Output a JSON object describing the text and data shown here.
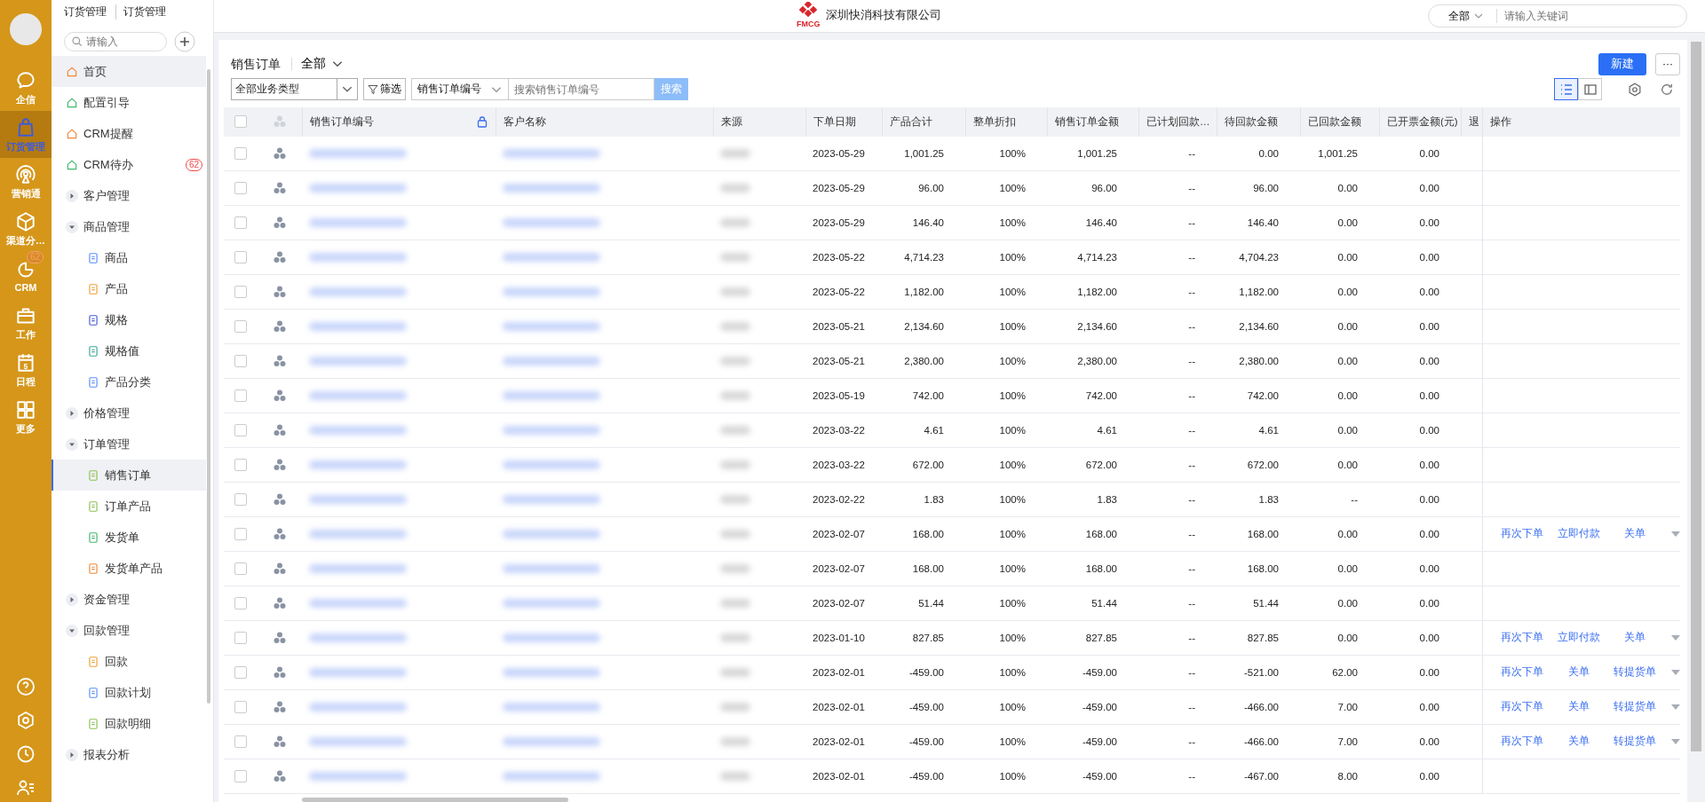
{
  "rail": {
    "items": [
      {
        "label": "企信",
        "selected": false
      },
      {
        "label": "订货管理",
        "selected": true
      },
      {
        "label": "营销通",
        "selected": false
      },
      {
        "label": "渠道分…",
        "selected": false
      },
      {
        "label": "CRM",
        "selected": false,
        "badge": "62"
      },
      {
        "label": "工作",
        "selected": false
      },
      {
        "label": "日程",
        "selected": false,
        "icon_text": "5"
      },
      {
        "label": "更多",
        "selected": false
      }
    ]
  },
  "header": {
    "breadcrumb": [
      "订货管理",
      "订货管理"
    ],
    "logo_text": "FMCG",
    "company": "深圳快消科技有限公司",
    "search": {
      "scope": "全部",
      "placeholder": "请输入关键词"
    }
  },
  "sidebar": {
    "search": {
      "placeholder": "请输入"
    },
    "items": [
      {
        "kind": "link",
        "label": "首页",
        "selected": false,
        "hovered": true
      },
      {
        "kind": "link",
        "label": "配置引导",
        "selected": false,
        "hovered": false
      },
      {
        "kind": "link",
        "label": "CRM提醒",
        "selected": false,
        "hovered": false
      },
      {
        "kind": "link",
        "label": "CRM待办",
        "selected": false,
        "hovered": false,
        "badge": "62"
      },
      {
        "kind": "group",
        "label": "客户管理",
        "expanded": false
      },
      {
        "kind": "group",
        "label": "商品管理",
        "expanded": true,
        "children": [
          {
            "label": "商品",
            "selected": false
          },
          {
            "label": "产品",
            "selected": false
          },
          {
            "label": "规格",
            "selected": false
          },
          {
            "label": "规格值",
            "selected": false
          },
          {
            "label": "产品分类",
            "selected": false
          }
        ]
      },
      {
        "kind": "group",
        "label": "价格管理",
        "expanded": false
      },
      {
        "kind": "group",
        "label": "订单管理",
        "expanded": true,
        "children": [
          {
            "label": "销售订单",
            "selected": true
          },
          {
            "label": "订单产品",
            "selected": false
          },
          {
            "label": "发货单",
            "selected": false
          },
          {
            "label": "发货单产品",
            "selected": false
          }
        ]
      },
      {
        "kind": "group",
        "label": "资金管理",
        "expanded": false
      },
      {
        "kind": "group",
        "label": "回款管理",
        "expanded": true,
        "children": [
          {
            "label": "回款",
            "selected": false
          },
          {
            "label": "回款计划",
            "selected": false
          },
          {
            "label": "回款明细",
            "selected": false
          }
        ]
      },
      {
        "kind": "group",
        "label": "报表分析",
        "expanded": false
      }
    ]
  },
  "page": {
    "title": "销售订单",
    "view": "全部",
    "new_button": "新建",
    "more_button": "···",
    "filters": {
      "type_select": "全部业务类型",
      "filter_button": "筛选",
      "field_select": "销售订单编号",
      "search_placeholder": "搜索销售订单编号",
      "search_button": "搜索"
    },
    "view_modes": [
      {
        "selected": true
      },
      {
        "selected": false
      }
    ]
  },
  "table": {
    "header_checked": false,
    "columns": [
      {
        "label": "销售订单编号",
        "locked": true
      },
      {
        "label": "客户名称"
      },
      {
        "label": "来源"
      },
      {
        "label": "下单日期"
      },
      {
        "label": "产品合计"
      },
      {
        "label": "整单折扣"
      },
      {
        "label": "销售订单金额"
      },
      {
        "label": "已计划回款…"
      },
      {
        "label": "待回款金额"
      },
      {
        "label": "已回款金额"
      },
      {
        "label": "已开票金额(元)"
      },
      {
        "label": "退"
      },
      {
        "label": "操作"
      }
    ],
    "rows": [
      {
        "checked": false,
        "date": "2023-05-29",
        "total": "1,001.25",
        "discount": "100%",
        "amount": "1,001.25",
        "planned": "--",
        "pending": "0.00",
        "received": "1,001.25",
        "invoiced": "0.00",
        "actions": []
      },
      {
        "checked": false,
        "date": "2023-05-29",
        "total": "96.00",
        "discount": "100%",
        "amount": "96.00",
        "planned": "--",
        "pending": "96.00",
        "received": "0.00",
        "invoiced": "0.00",
        "actions": []
      },
      {
        "checked": false,
        "date": "2023-05-29",
        "total": "146.40",
        "discount": "100%",
        "amount": "146.40",
        "planned": "--",
        "pending": "146.40",
        "received": "0.00",
        "invoiced": "0.00",
        "actions": []
      },
      {
        "checked": false,
        "date": "2023-05-22",
        "total": "4,714.23",
        "discount": "100%",
        "amount": "4,714.23",
        "planned": "--",
        "pending": "4,704.23",
        "received": "0.00",
        "invoiced": "0.00",
        "actions": []
      },
      {
        "checked": false,
        "date": "2023-05-22",
        "total": "1,182.00",
        "discount": "100%",
        "amount": "1,182.00",
        "planned": "--",
        "pending": "1,182.00",
        "received": "0.00",
        "invoiced": "0.00",
        "actions": []
      },
      {
        "checked": false,
        "date": "2023-05-21",
        "total": "2,134.60",
        "discount": "100%",
        "amount": "2,134.60",
        "planned": "--",
        "pending": "2,134.60",
        "received": "0.00",
        "invoiced": "0.00",
        "actions": []
      },
      {
        "checked": false,
        "date": "2023-05-21",
        "total": "2,380.00",
        "discount": "100%",
        "amount": "2,380.00",
        "planned": "--",
        "pending": "2,380.00",
        "received": "0.00",
        "invoiced": "0.00",
        "actions": []
      },
      {
        "checked": false,
        "date": "2023-05-19",
        "total": "742.00",
        "discount": "100%",
        "amount": "742.00",
        "planned": "--",
        "pending": "742.00",
        "received": "0.00",
        "invoiced": "0.00",
        "actions": []
      },
      {
        "checked": false,
        "date": "2023-03-22",
        "total": "4.61",
        "discount": "100%",
        "amount": "4.61",
        "planned": "--",
        "pending": "4.61",
        "received": "0.00",
        "invoiced": "0.00",
        "actions": []
      },
      {
        "checked": false,
        "date": "2023-03-22",
        "total": "672.00",
        "discount": "100%",
        "amount": "672.00",
        "planned": "--",
        "pending": "672.00",
        "received": "0.00",
        "invoiced": "0.00",
        "actions": []
      },
      {
        "checked": false,
        "date": "2023-02-22",
        "total": "1.83",
        "discount": "100%",
        "amount": "1.83",
        "planned": "--",
        "pending": "1.83",
        "received": "--",
        "invoiced": "0.00",
        "actions": []
      },
      {
        "checked": false,
        "date": "2023-02-07",
        "total": "168.00",
        "discount": "100%",
        "amount": "168.00",
        "planned": "--",
        "pending": "168.00",
        "received": "0.00",
        "invoiced": "0.00",
        "actions": [
          "再次下单",
          "立即付款",
          "关单"
        ]
      },
      {
        "checked": false,
        "date": "2023-02-07",
        "total": "168.00",
        "discount": "100%",
        "amount": "168.00",
        "planned": "--",
        "pending": "168.00",
        "received": "0.00",
        "invoiced": "0.00",
        "actions": []
      },
      {
        "checked": false,
        "date": "2023-02-07",
        "total": "51.44",
        "discount": "100%",
        "amount": "51.44",
        "planned": "--",
        "pending": "51.44",
        "received": "0.00",
        "invoiced": "0.00",
        "actions": []
      },
      {
        "checked": false,
        "date": "2023-01-10",
        "total": "827.85",
        "discount": "100%",
        "amount": "827.85",
        "planned": "--",
        "pending": "827.85",
        "received": "0.00",
        "invoiced": "0.00",
        "actions": [
          "再次下单",
          "立即付款",
          "关单"
        ]
      },
      {
        "checked": false,
        "date": "2023-02-01",
        "total": "-459.00",
        "discount": "100%",
        "amount": "-459.00",
        "planned": "--",
        "pending": "-521.00",
        "received": "62.00",
        "invoiced": "0.00",
        "actions": [
          "再次下单",
          "关单",
          "转提货单"
        ]
      },
      {
        "checked": false,
        "date": "2023-02-01",
        "total": "-459.00",
        "discount": "100%",
        "amount": "-459.00",
        "planned": "--",
        "pending": "-466.00",
        "received": "7.00",
        "invoiced": "0.00",
        "actions": [
          "再次下单",
          "关单",
          "转提货单"
        ]
      },
      {
        "checked": false,
        "date": "2023-02-01",
        "total": "-459.00",
        "discount": "100%",
        "amount": "-459.00",
        "planned": "--",
        "pending": "-466.00",
        "received": "7.00",
        "invoiced": "0.00",
        "actions": [
          "再次下单",
          "关单",
          "转提货单"
        ]
      },
      {
        "checked": false,
        "date": "2023-02-01",
        "total": "-459.00",
        "discount": "100%",
        "amount": "-459.00",
        "planned": "--",
        "pending": "-467.00",
        "received": "8.00",
        "invoiced": "0.00",
        "actions": []
      }
    ]
  }
}
